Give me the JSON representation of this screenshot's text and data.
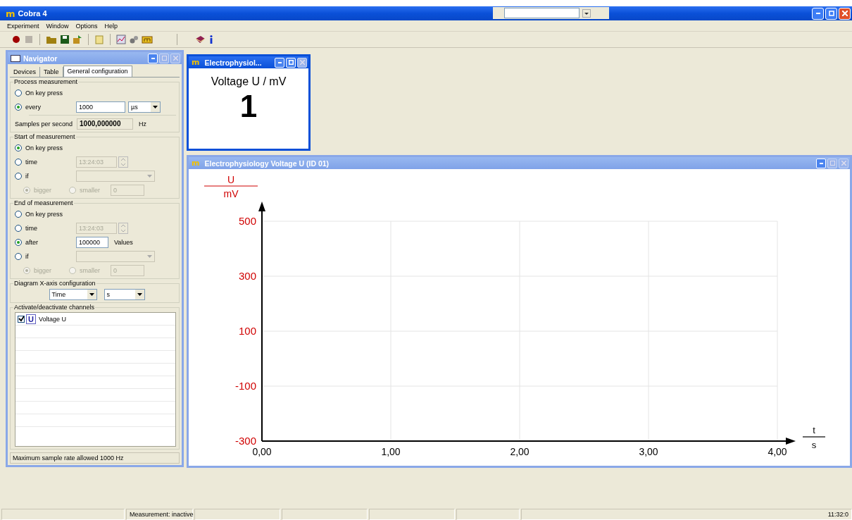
{
  "window": {
    "logo": "m",
    "title": "Cobra 4"
  },
  "menu": [
    {
      "label": "Experiment"
    },
    {
      "label": "Window"
    },
    {
      "label": "Options"
    },
    {
      "label": "Help"
    }
  ],
  "navigator": {
    "title": "Navigator",
    "tabs": [
      {
        "label": "Devices",
        "selected": false
      },
      {
        "label": "Table",
        "selected": false
      },
      {
        "label": "General configuration",
        "selected": true
      }
    ],
    "process": {
      "legend": "Process measurement",
      "options": [
        {
          "kind": "plain",
          "label": "On key press",
          "selected": false
        },
        {
          "kind": "interval",
          "label": "every",
          "selected": true,
          "value": "1000",
          "unit": "µs"
        }
      ],
      "samples_label": "Samples per second",
      "samples_value": "1000,000000",
      "samples_unit": "Hz"
    },
    "start": {
      "legend": "Start of measurement",
      "options": [
        {
          "kind": "plain",
          "label": "On key press",
          "selected": true
        },
        {
          "kind": "time",
          "label": "time",
          "selected": false,
          "value": "13:24:03",
          "disabled": true
        },
        {
          "kind": "combo",
          "label": "if",
          "selected": false,
          "disabled": true
        },
        {
          "kind": "compare",
          "bigger": "bigger",
          "bigger_selected": true,
          "smaller": "smaller",
          "smaller_selected": false,
          "value": "0",
          "disabled": true
        }
      ]
    },
    "end": {
      "legend": "End of measurement",
      "options": [
        {
          "kind": "plain",
          "label": "On key press",
          "selected": false
        },
        {
          "kind": "time",
          "label": "time",
          "selected": false,
          "value": "13:24:03",
          "disabled": true
        },
        {
          "kind": "count",
          "label": "after",
          "selected": true,
          "value": "100000",
          "unit": "Values"
        },
        {
          "kind": "combo",
          "label": "if",
          "selected": false,
          "disabled": true
        },
        {
          "kind": "compare",
          "bigger": "bigger",
          "bigger_selected": true,
          "smaller": "smaller",
          "smaller_selected": false,
          "value": "0",
          "disabled": true
        }
      ]
    },
    "xaxis": {
      "legend": "Diagram X-axis configuration",
      "quantity": "Time",
      "unit": "s"
    },
    "channels": {
      "legend": "Activate/deactivate channels",
      "items": [
        {
          "symbol": "U",
          "label": "Voltage U",
          "checked": true
        }
      ]
    },
    "status": "Maximum sample rate allowed 1000 Hz"
  },
  "display": {
    "logo": "m",
    "title": "Electrophysiol...",
    "label": "Voltage U / mV",
    "value": "1"
  },
  "diagram": {
    "logo": "m",
    "title": "Electrophysiology  Voltage U (ID 01)",
    "y_unit": "mV",
    "x_unit": "s",
    "chart_data": {
      "type": "line",
      "xlabel": "t",
      "ylabel": "U",
      "xlim": [
        0,
        4
      ],
      "ylim": [
        -300,
        500
      ],
      "grid": true,
      "xticks": [
        {
          "value": 0,
          "label": "0,00"
        },
        {
          "value": 1,
          "label": "1,00"
        },
        {
          "value": 2,
          "label": "2,00"
        },
        {
          "value": 3,
          "label": "3,00"
        },
        {
          "value": 4,
          "label": "4,00"
        }
      ],
      "yticks": [
        500,
        300,
        100,
        -100,
        -300
      ]
    }
  },
  "status_bar": {
    "status": "Measurement: inactive",
    "clock": "11:32:0"
  }
}
